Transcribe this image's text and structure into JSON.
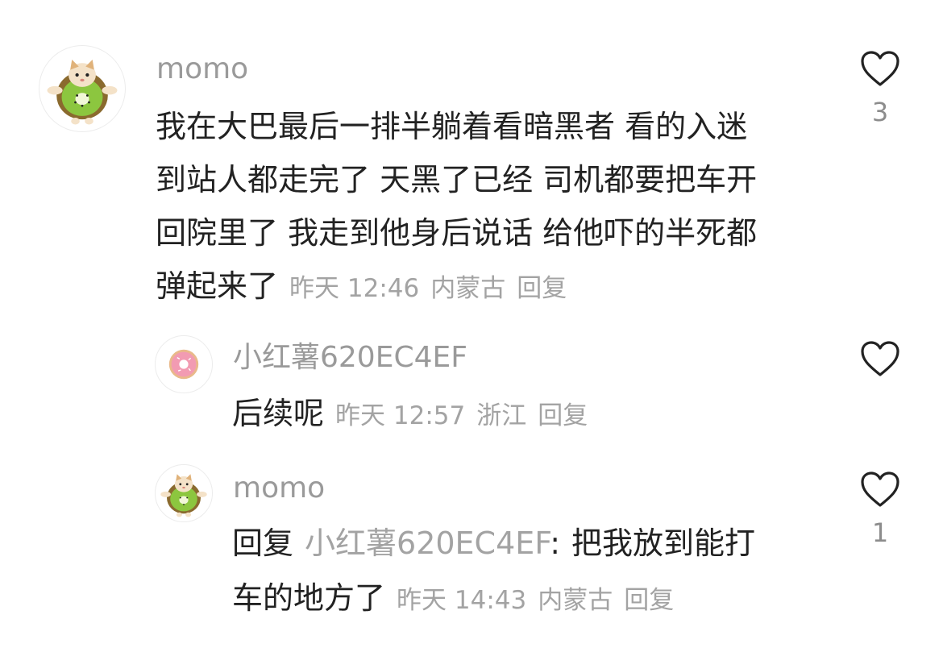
{
  "comments": [
    {
      "username": "momo",
      "lines": [
        "我在大巴最后一排半躺着看暗黑者 看的入迷",
        "到站人都走完了 天黑了已经 司机都要把车开",
        "回院里了 我走到他身后说话 给他吓的半死都",
        "弹起来了"
      ],
      "time": "昨天 12:46",
      "location": "内蒙古",
      "reply_label": "回复",
      "like_count": "3",
      "avatar_icon": "kiwi-cat-avatar-icon"
    },
    {
      "username": "小红薯620EC4EF",
      "lines": [
        "后续呢"
      ],
      "time": "昨天 12:57",
      "location": "浙江",
      "reply_label": "回复",
      "like_count": "",
      "avatar_icon": "donut-avatar-icon"
    },
    {
      "username": "momo",
      "reply_prefix": "回复",
      "reply_target": "小红薯620EC4EF",
      "reply_sep": ":",
      "lines": [
        "把我放到能打",
        "车的地方了"
      ],
      "time": "昨天 14:43",
      "location": "内蒙古",
      "reply_label": "回复",
      "like_count": "1",
      "avatar_icon": "kiwi-cat-avatar-icon"
    }
  ],
  "colors": {
    "text": "#222222",
    "muted": "#9a9a9a",
    "kiwi_skin": "#8a6a2e",
    "kiwi_flesh": "#8cc63f",
    "donut_pink": "#f29bb2"
  }
}
